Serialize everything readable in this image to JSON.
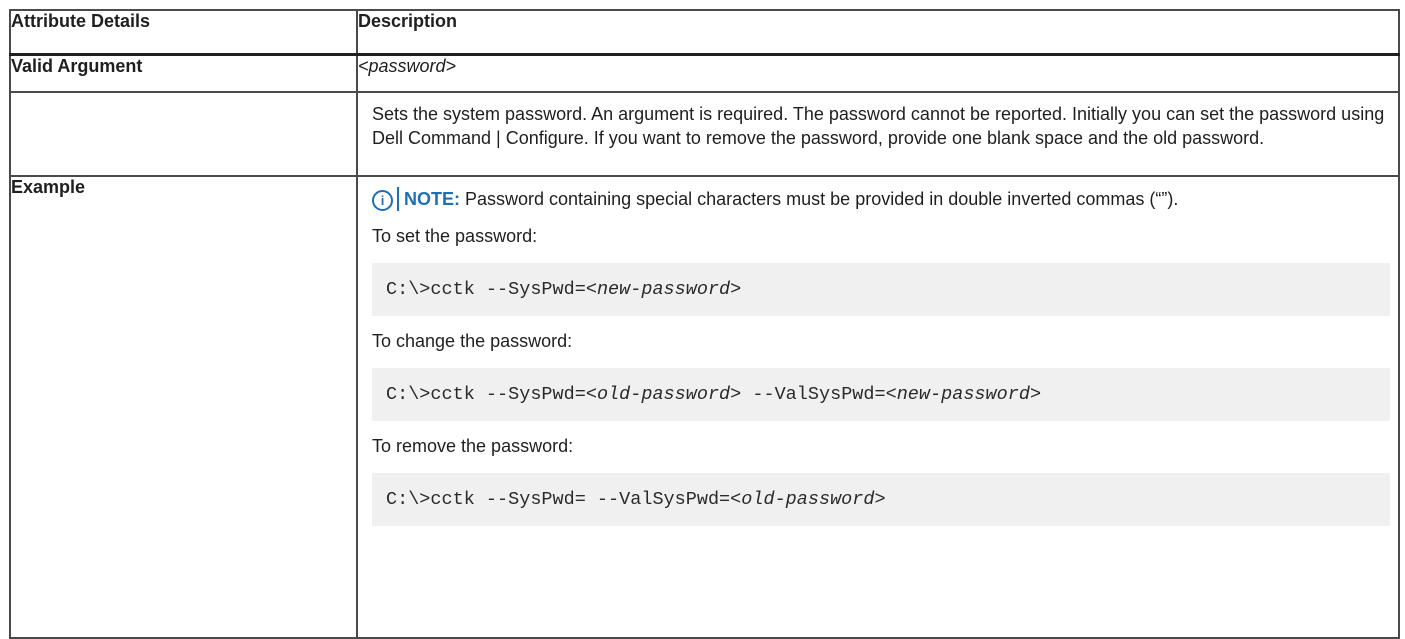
{
  "table": {
    "headers": [
      "Attribute Details",
      "Description"
    ],
    "valid_argument": {
      "label": "Valid Argument",
      "value": "<password>"
    },
    "description": "Sets the system password. An argument is required. The password cannot be reported. Initially you can set the password using Dell Command | Configure. If you want to remove the password, provide one blank space and the old password.",
    "example": {
      "label": "Example",
      "note_label": "NOTE:",
      "note_text": " Password containing special characters must be provided in double inverted commas (“”).",
      "set_intro": "To set the password:",
      "set_cmd_prefix": "C:\\>cctk --SysPwd=<",
      "set_cmd_arg": "new-password",
      "set_cmd_suffix": ">",
      "change_intro": "To change the password:",
      "change_cmd_prefix": "C:\\>cctk --SysPwd=<",
      "change_cmd_arg1": "old-password",
      "change_cmd_middle": "> --ValSysPwd=<",
      "change_cmd_arg2": "new-password",
      "change_cmd_suffix": ">",
      "remove_intro": "To remove the password:",
      "remove_cmd_prefix": "C:\\>cctk --SysPwd= --ValSysPwd=<",
      "remove_cmd_arg": "old-password",
      "remove_cmd_suffix": ">"
    }
  },
  "icons": {
    "note": "info-circle-icon",
    "note_glyph": "i"
  },
  "colors": {
    "note_accent": "#1f6fb5",
    "code_background": "#f0f0f0",
    "border": "#4a4a4a"
  }
}
